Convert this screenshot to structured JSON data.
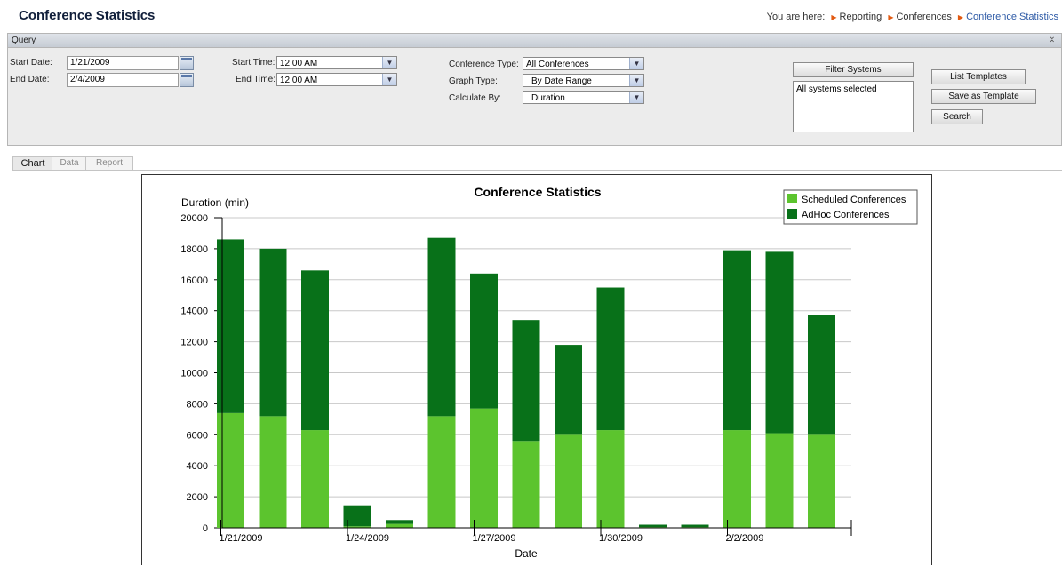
{
  "header": {
    "title": "Conference Statistics",
    "you_are_here": "You are here:",
    "crumbs": [
      "Reporting",
      "Conferences",
      "Conference Statistics"
    ]
  },
  "query": {
    "title": "Query",
    "start_date_label": "Start Date:",
    "start_date": "1/21/2009",
    "end_date_label": "End Date:",
    "end_date": "2/4/2009",
    "start_time_label": "Start Time:",
    "start_time": "12:00 AM",
    "end_time_label": "End Time:",
    "end_time": "12:00 AM",
    "conf_type_label": "Conference Type:",
    "conf_type": "All Conferences",
    "graph_type_label": "Graph Type:",
    "graph_type": "By Date Range",
    "calc_by_label": "Calculate By:",
    "calc_by": "Duration",
    "filter_systems": "Filter Systems",
    "systems_selected": "All systems selected",
    "list_templates": "List Templates",
    "save_template": "Save as Template",
    "search": "Search"
  },
  "tabs": [
    "Chart",
    "Data",
    "Report"
  ],
  "colors": {
    "scheduled": "#5cc42e",
    "adhoc": "#087119",
    "accent": "#2d5aa6"
  },
  "chart_data": {
    "type": "bar",
    "stacked": true,
    "title": "Conference Statistics",
    "ylabel": "Duration (min)",
    "xlabel": "Date",
    "ylim": [
      0,
      20000
    ],
    "yticks": [
      0,
      2000,
      4000,
      6000,
      8000,
      10000,
      12000,
      14000,
      16000,
      18000,
      20000
    ],
    "x_tick_labels": [
      "1/21/2009",
      "1/24/2009",
      "1/27/2009",
      "1/30/2009",
      "2/2/2009"
    ],
    "categories": [
      "1/21/2009",
      "1/22/2009",
      "1/23/2009",
      "1/24/2009",
      "1/25/2009",
      "1/26/2009",
      "1/27/2009",
      "1/28/2009",
      "1/29/2009",
      "1/30/2009",
      "1/31/2009",
      "2/1/2009",
      "2/2/2009",
      "2/3/2009",
      "2/4/2009"
    ],
    "series": [
      {
        "name": "Scheduled Conferences",
        "values": [
          7400,
          7200,
          6300,
          100,
          250,
          7200,
          7700,
          5600,
          6000,
          6300,
          50,
          50,
          6300,
          6100,
          6000
        ]
      },
      {
        "name": "AdHoc Conferences",
        "values": [
          11200,
          10800,
          10300,
          1350,
          250,
          11500,
          8700,
          7800,
          5800,
          9200,
          150,
          150,
          11600,
          11700,
          7700
        ]
      }
    ],
    "legend_position": "top-right",
    "grid": true
  }
}
